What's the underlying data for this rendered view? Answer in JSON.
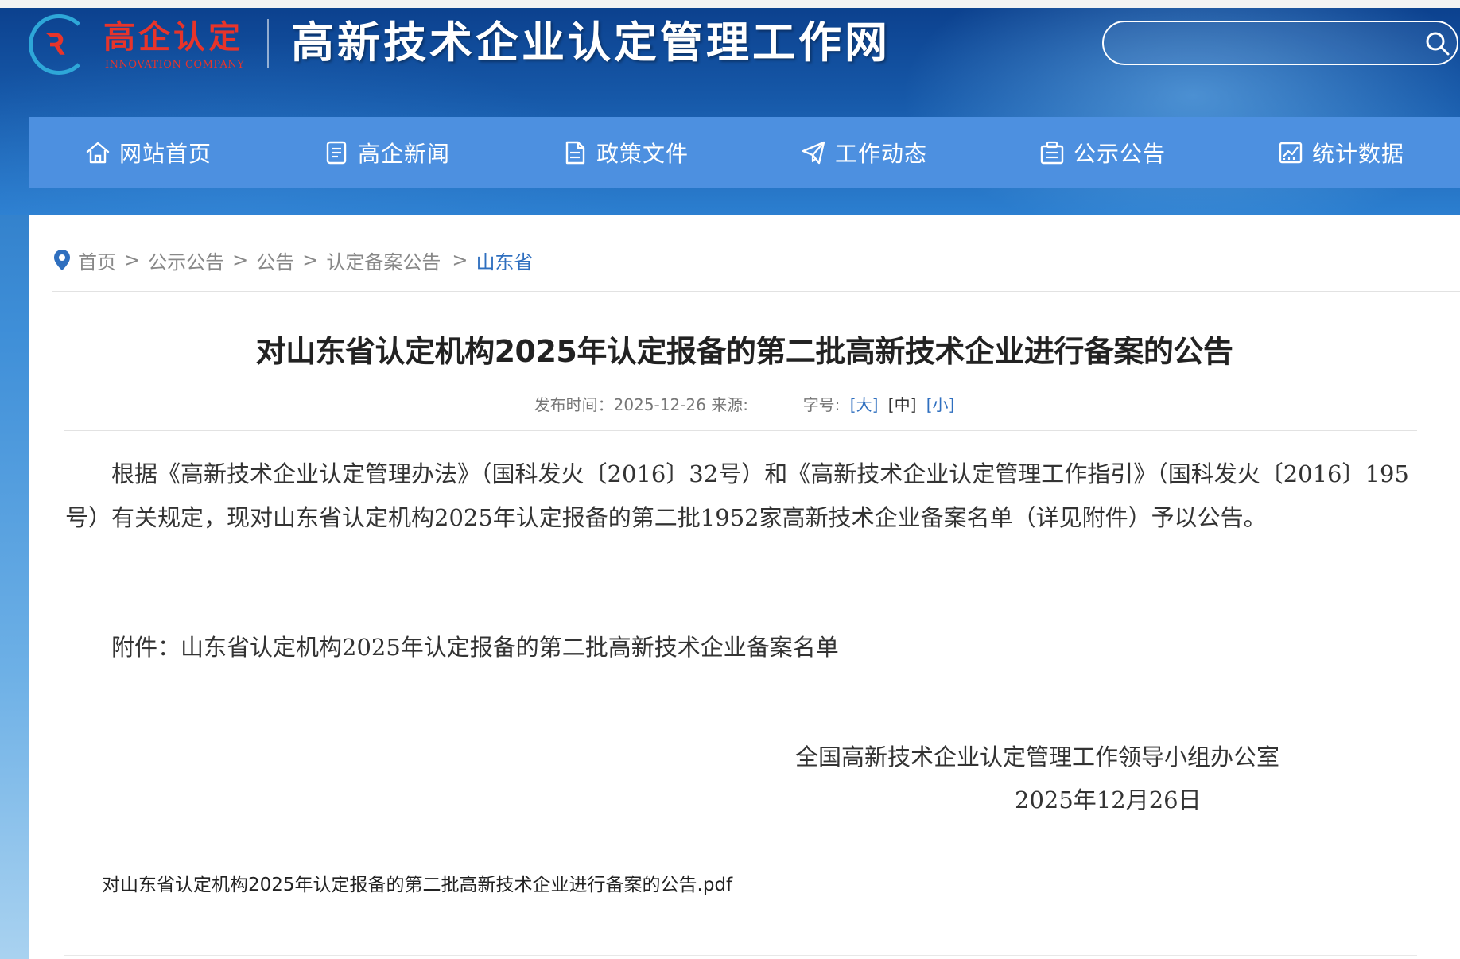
{
  "header": {
    "logo_cn": "高企认定",
    "logo_en": "INNOVATION COMPANY",
    "site_title": "高新技术企业认定管理工作网",
    "search_placeholder": ""
  },
  "nav": {
    "items": [
      {
        "label": "网站首页",
        "icon": "home-icon"
      },
      {
        "label": "高企新闻",
        "icon": "news-icon"
      },
      {
        "label": "政策文件",
        "icon": "document-icon"
      },
      {
        "label": "工作动态",
        "icon": "paper-plane-icon"
      },
      {
        "label": "公示公告",
        "icon": "announcement-icon"
      },
      {
        "label": "统计数据",
        "icon": "chart-icon"
      }
    ]
  },
  "breadcrumb": {
    "items": [
      "首页",
      "公示公告",
      "公告",
      "认定备案公告",
      "山东省"
    ],
    "separator": ">"
  },
  "article": {
    "title": "对山东省认定机构2025年认定报备的第二批高新技术企业进行备案的公告",
    "publish_label": "发布时间：2025-12-26 来源:",
    "font_size_label": "字号:",
    "font_size_options": [
      "[大]",
      "[中]",
      "[小]"
    ],
    "paragraph": "根据《高新技术企业认定管理办法》（国科发火〔2016〕32号）和《高新技术企业认定管理工作指引》（国科发火〔2016〕195号）有关规定，现对山东省认定机构2025年认定报备的第二批1952家高新技术企业备案名单（详见附件）予以公告。",
    "attachment_note": "附件：山东省认定机构2025年认定报备的第二批高新技术企业备案名单",
    "signature": "全国高新技术企业认定管理工作领导小组办公室",
    "sign_date": "2025年12月26日",
    "attachment_file": "对山东省认定机构2025年认定报备的第二批高新技术企业进行备案的公告.pdf"
  },
  "colors": {
    "nav_bg": "#4d90e0",
    "link_blue": "#2f6fbf",
    "brand_red": "#e8342a"
  }
}
